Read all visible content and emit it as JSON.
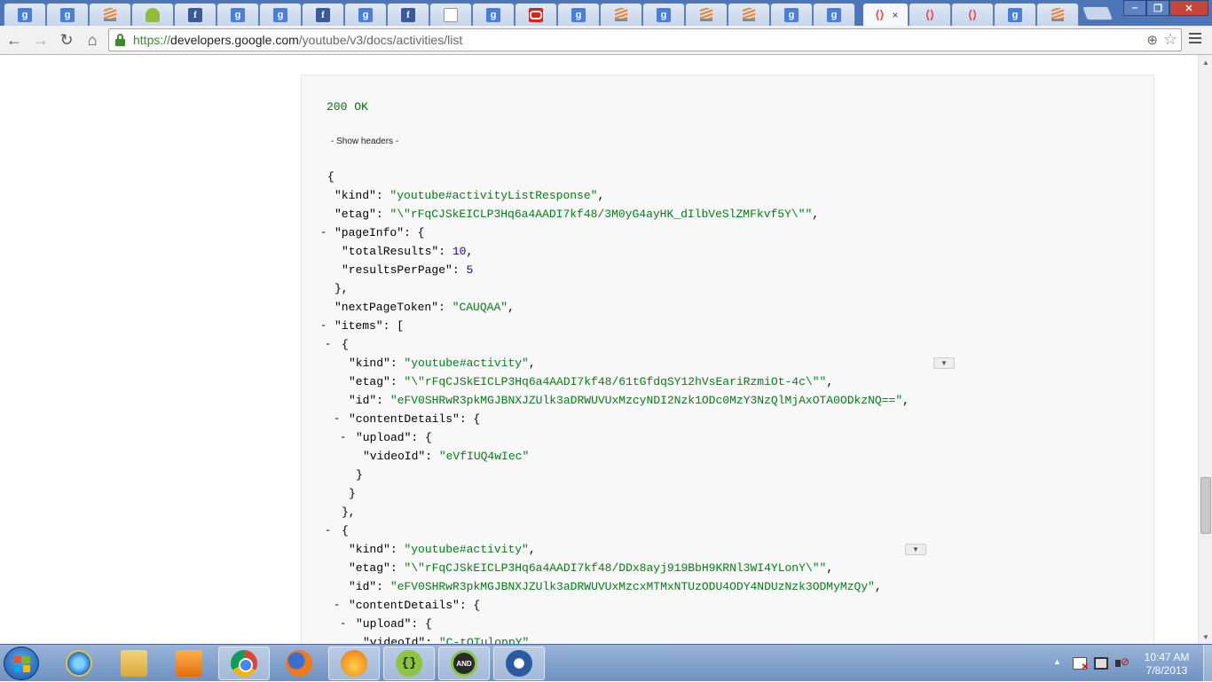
{
  "browser": {
    "active_tab_close": "×",
    "url_scheme": "https://",
    "url_host": "developers.google.com",
    "url_path": "/youtube/v3/docs/activities/list"
  },
  "response": {
    "status": "200 OK",
    "show_headers": "- Show headers -",
    "lines": [
      {
        "k": "{"
      },
      {
        "k": "\"kind\"",
        "p": ": ",
        "s": "\"youtube#activityListResponse\"",
        "t": ","
      },
      {
        "k": "\"etag\"",
        "p": ": ",
        "s": "\"\\\"rFqCJSkEICLP3Hq6a4AADI7kf48/3M0yG4ayHK_dIlbVeSlZMFkvf5Y\\\"\"",
        "t": ","
      },
      {
        "k": "\"pageInfo\"",
        "p": ": {"
      },
      {
        "k": "\"totalResults\"",
        "p": ": ",
        "n": "10",
        "t": ","
      },
      {
        "k": "\"resultsPerPage\"",
        "p": ": ",
        "n": "5"
      },
      {
        "k": "},"
      },
      {
        "k": "\"nextPageToken\"",
        "p": ": ",
        "s": "\"CAUQAA\"",
        "t": ","
      },
      {
        "k": "\"items\"",
        "p": ": ["
      },
      {
        "k": "{"
      },
      {
        "k": "\"kind\"",
        "p": ": ",
        "s": "\"youtube#activity\"",
        "t": ","
      },
      {
        "k": "\"etag\"",
        "p": ": ",
        "s": "\"\\\"rFqCJSkEICLP3Hq6a4AADI7kf48/61tGfdqSY12hVsEariRzmiOt-4c\\\"\"",
        "t": ","
      },
      {
        "k": "\"id\"",
        "p": ": ",
        "s": "\"eFV0SHRwR3pkMGJBNXJZUlk3aDRWUVUxMzcyNDI2Nzk1ODc0MzY3NzQlMjAxOTA0ODkzNQ==\"",
        "t": ","
      },
      {
        "k": "\"contentDetails\"",
        "p": ": {"
      },
      {
        "k": "\"upload\"",
        "p": ": {"
      },
      {
        "k": "\"videoId\"",
        "p": ": ",
        "s": "\"eVfIUQ4wIec\""
      },
      {
        "k": "}"
      },
      {
        "k": "}"
      },
      {
        "k": "},"
      },
      {
        "k": "{"
      },
      {
        "k": "\"kind\"",
        "p": ": ",
        "s": "\"youtube#activity\"",
        "t": ","
      },
      {
        "k": "\"etag\"",
        "p": ": ",
        "s": "\"\\\"rFqCJSkEICLP3Hq6a4AADI7kf48/DDx8ayj919BbH9KRNl3WI4YLonY\\\"\"",
        "t": ","
      },
      {
        "k": "\"id\"",
        "p": ": ",
        "s": "\"eFV0SHRwR3pkMGJBNXJZUlk3aDRWUVUxMzcxMTMxNTUzODU4ODY4NDUzNzk3ODMyMzQy\"",
        "t": ","
      },
      {
        "k": "\"contentDetails\"",
        "p": ": {"
      },
      {
        "k": "\"upload\"",
        "p": ": {"
      },
      {
        "k": "\"videoId\"",
        "p": ": ",
        "s": "\"C-tOTuloppY\""
      }
    ]
  },
  "taskbar": {
    "clock_time": "10:47 AM",
    "clock_date": "7/8/2013",
    "and_label": "AND"
  }
}
